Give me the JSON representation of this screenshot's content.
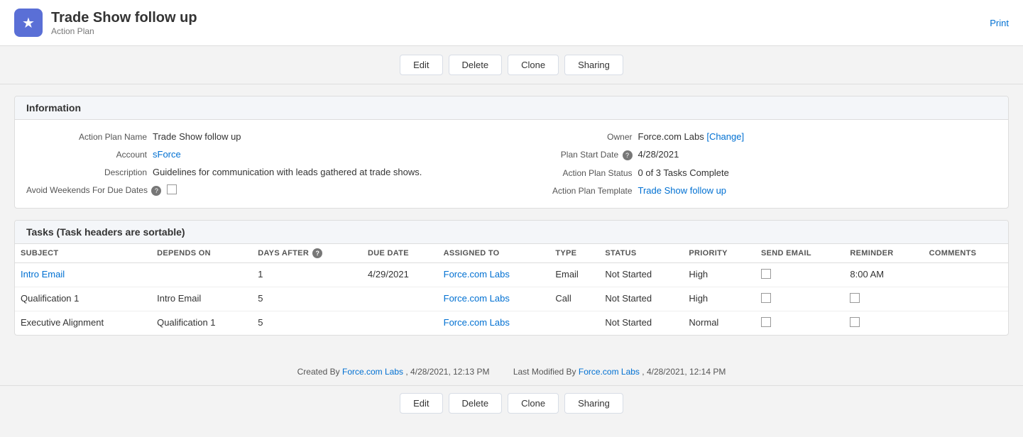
{
  "header": {
    "icon": "★",
    "title": "Trade Show follow up",
    "subtitle": "Action Plan",
    "print_label": "Print"
  },
  "toolbar": {
    "edit_label": "Edit",
    "delete_label": "Delete",
    "clone_label": "Clone",
    "sharing_label": "Sharing"
  },
  "information_section": {
    "heading": "Information",
    "fields": {
      "action_plan_name_label": "Action Plan Name",
      "action_plan_name_value": "Trade Show follow up",
      "account_label": "Account",
      "account_value": "sForce",
      "description_label": "Description",
      "description_value": "Guidelines for communication with leads gathered at trade shows.",
      "avoid_weekends_label": "Avoid Weekends For Due Dates",
      "owner_label": "Owner",
      "owner_value": "Force.com Labs",
      "owner_change": "[Change]",
      "plan_start_date_label": "Plan Start Date",
      "plan_start_date_value": "4/28/2021",
      "action_plan_status_label": "Action Plan Status",
      "action_plan_status_value": "0 of 3 Tasks Complete",
      "action_plan_template_label": "Action Plan Template",
      "action_plan_template_value": "Trade Show follow up"
    }
  },
  "tasks_section": {
    "heading": "Tasks (Task headers are sortable)",
    "columns": {
      "subject": "SUBJECT",
      "depends_on": "DEPENDS ON",
      "days_after": "DAYS AFTER",
      "due_date": "DUE DATE",
      "assigned_to": "ASSIGNED TO",
      "type": "TYPE",
      "status": "STATUS",
      "priority": "PRIORITY",
      "send_email": "SEND EMAIL",
      "reminder": "REMINDER",
      "comments": "COMMENTS"
    },
    "rows": [
      {
        "subject": "Intro Email",
        "subject_link": true,
        "depends_on": "",
        "days_after": "1",
        "due_date": "4/29/2021",
        "assigned_to": "Force.com Labs",
        "type": "Email",
        "status": "Not Started",
        "priority": "High",
        "send_email": false,
        "reminder": "8:00 AM",
        "comments": ""
      },
      {
        "subject": "Qualification 1",
        "subject_link": false,
        "depends_on": "Intro Email",
        "days_after": "5",
        "due_date": "",
        "assigned_to": "Force.com Labs",
        "type": "Call",
        "status": "Not Started",
        "priority": "High",
        "send_email": false,
        "reminder": "",
        "comments": ""
      },
      {
        "subject": "Executive Alignment",
        "subject_link": false,
        "depends_on": "Qualification 1",
        "days_after": "5",
        "due_date": "",
        "assigned_to": "Force.com Labs",
        "type": "",
        "status": "Not Started",
        "priority": "Normal",
        "send_email": false,
        "reminder": "",
        "comments": ""
      }
    ]
  },
  "footer": {
    "created_by_label": "Created By",
    "created_by_value": "Force.com Labs",
    "created_date": ", 4/28/2021, 12:13 PM",
    "last_modified_label": "Last Modified By",
    "last_modified_value": "Force.com Labs",
    "last_modified_date": ", 4/28/2021, 12:14 PM"
  },
  "bottom_toolbar": {
    "edit_label": "Edit",
    "delete_label": "Delete",
    "clone_label": "Clone",
    "sharing_label": "Sharing"
  }
}
